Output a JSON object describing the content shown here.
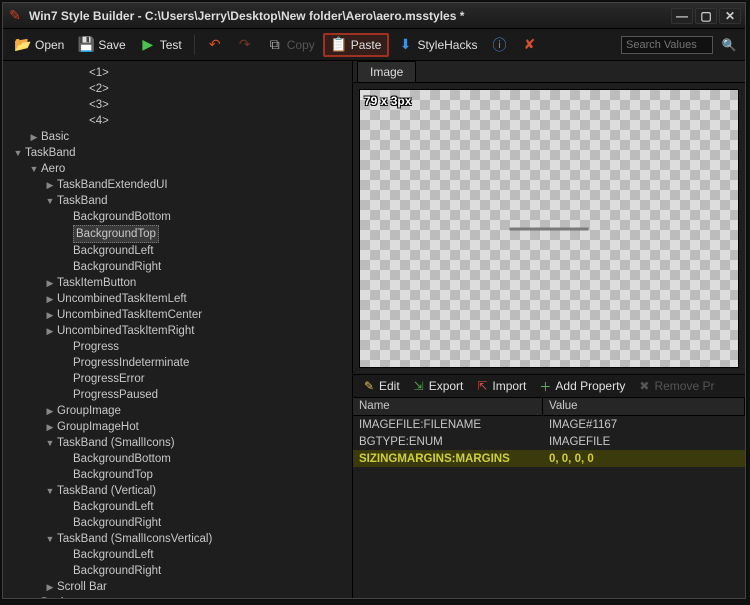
{
  "window": {
    "title": "Win7 Style Builder - C:\\Users\\Jerry\\Desktop\\New folder\\Aero\\aero.msstyles *"
  },
  "toolbar": {
    "open": "Open",
    "save": "Save",
    "test": "Test",
    "copy": "Copy",
    "paste": "Paste",
    "stylehacks": "StyleHacks",
    "search_placeholder": "Search Values"
  },
  "tree": {
    "items": [
      {
        "label": "<1>",
        "depth": 4,
        "expand": ""
      },
      {
        "label": "<2>",
        "depth": 4,
        "expand": ""
      },
      {
        "label": "<3>",
        "depth": 4,
        "expand": ""
      },
      {
        "label": "<4>",
        "depth": 4,
        "expand": ""
      },
      {
        "label": "Basic",
        "depth": 1,
        "expand": "▶"
      },
      {
        "label": "TaskBand",
        "depth": 0,
        "expand": "▼"
      },
      {
        "label": "Aero",
        "depth": 1,
        "expand": "▼"
      },
      {
        "label": "TaskBandExtendedUI",
        "depth": 2,
        "expand": "▶"
      },
      {
        "label": "TaskBand",
        "depth": 2,
        "expand": "▼"
      },
      {
        "label": "BackgroundBottom",
        "depth": 3,
        "expand": ""
      },
      {
        "label": "BackgroundTop",
        "depth": 3,
        "expand": "",
        "selected": true
      },
      {
        "label": "BackgroundLeft",
        "depth": 3,
        "expand": ""
      },
      {
        "label": "BackgroundRight",
        "depth": 3,
        "expand": ""
      },
      {
        "label": "TaskItemButton",
        "depth": 2,
        "expand": "▶"
      },
      {
        "label": "UncombinedTaskItemLeft",
        "depth": 2,
        "expand": "▶"
      },
      {
        "label": "UncombinedTaskItemCenter",
        "depth": 2,
        "expand": "▶"
      },
      {
        "label": "UncombinedTaskItemRight",
        "depth": 2,
        "expand": "▶"
      },
      {
        "label": "Progress",
        "depth": 3,
        "expand": ""
      },
      {
        "label": "ProgressIndeterminate",
        "depth": 3,
        "expand": ""
      },
      {
        "label": "ProgressError",
        "depth": 3,
        "expand": ""
      },
      {
        "label": "ProgressPaused",
        "depth": 3,
        "expand": ""
      },
      {
        "label": "GroupImage",
        "depth": 2,
        "expand": "▶"
      },
      {
        "label": "GroupImageHot",
        "depth": 2,
        "expand": "▶"
      },
      {
        "label": "TaskBand (SmallIcons)",
        "depth": 2,
        "expand": "▼"
      },
      {
        "label": "BackgroundBottom",
        "depth": 3,
        "expand": ""
      },
      {
        "label": "BackgroundTop",
        "depth": 3,
        "expand": ""
      },
      {
        "label": "TaskBand (Vertical)",
        "depth": 2,
        "expand": "▼"
      },
      {
        "label": "BackgroundLeft",
        "depth": 3,
        "expand": ""
      },
      {
        "label": "BackgroundRight",
        "depth": 3,
        "expand": ""
      },
      {
        "label": "TaskBand (SmallIconsVertical)",
        "depth": 2,
        "expand": "▼"
      },
      {
        "label": "BackgroundLeft",
        "depth": 3,
        "expand": ""
      },
      {
        "label": "BackgroundRight",
        "depth": 3,
        "expand": ""
      },
      {
        "label": "Scroll Bar",
        "depth": 2,
        "expand": "▶"
      },
      {
        "label": "Basic",
        "depth": 1,
        "expand": "▶"
      }
    ]
  },
  "tabs": {
    "image": "Image"
  },
  "preview": {
    "dimensions": "79 x 3px"
  },
  "prop_toolbar": {
    "edit": "Edit",
    "export": "Export",
    "import": "Import",
    "add": "Add Property",
    "remove": "Remove Pr"
  },
  "prop_table": {
    "head_name": "Name",
    "head_value": "Value",
    "rows": [
      {
        "name": "IMAGEFILE:FILENAME",
        "value": "IMAGE#1167"
      },
      {
        "name": "BGTYPE:ENUM",
        "value": "IMAGEFILE"
      },
      {
        "name": "SIZINGMARGINS:MARGINS",
        "value": "0, 0, 0, 0",
        "hl": true
      }
    ]
  }
}
